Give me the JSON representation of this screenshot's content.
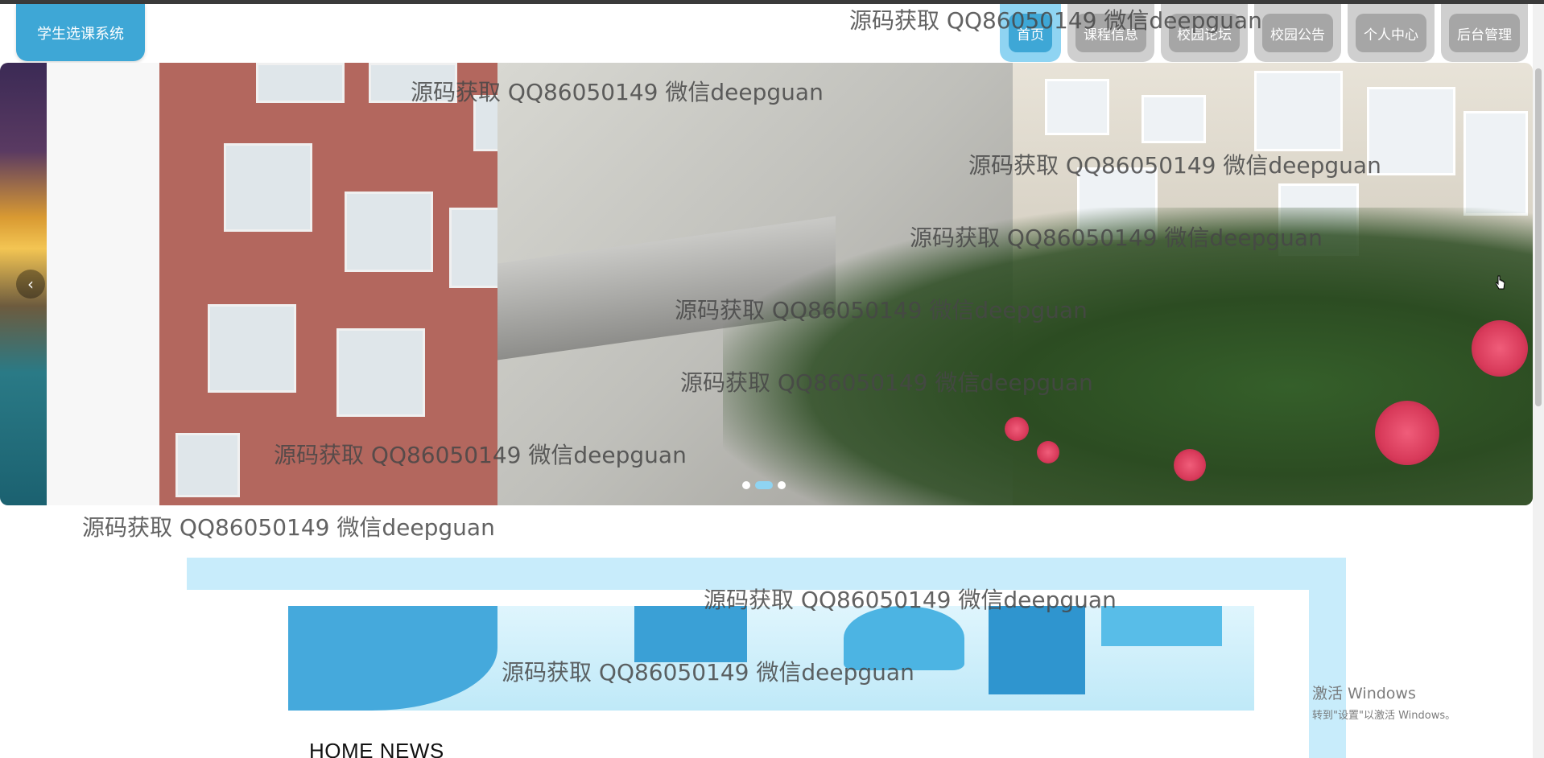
{
  "header": {
    "logo_text": "学生选课系统"
  },
  "nav": {
    "items": [
      {
        "label": "首页",
        "active": true
      },
      {
        "label": "课程信息",
        "active": false
      },
      {
        "label": "校园论坛",
        "active": false
      },
      {
        "label": "校园公告",
        "active": false
      },
      {
        "label": "个人中心",
        "active": false
      },
      {
        "label": "后台管理",
        "active": false
      }
    ]
  },
  "carousel": {
    "prev_icon": "chevron-left-icon",
    "prev_glyph": "‹",
    "slide_count": 3,
    "active_slide": 2
  },
  "news": {
    "title": "HOME NEWS"
  },
  "watermark": {
    "text": "源码获取 QQ86050149 微信deepguan"
  },
  "os_overlay": {
    "line1": "激活 Windows",
    "line2": "转到\"设置\"以激活 Windows。"
  },
  "colors": {
    "accent": "#3ea7d6",
    "nav_inactive": "#a6a6a6",
    "panel_bg": "#c8ecfb"
  }
}
